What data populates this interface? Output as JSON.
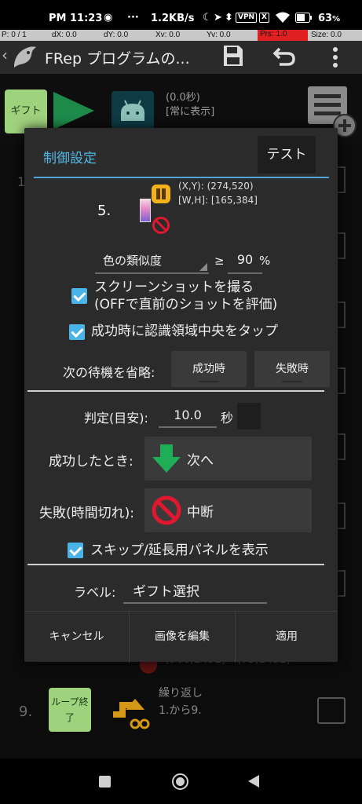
{
  "status_bar": {
    "time": "PM 11:23",
    "dots": "···",
    "speed": "1.2KB/s",
    "vpn": "VPN",
    "x_icon": "X",
    "battery": "63",
    "battery_unit": "%"
  },
  "pointer_bar": {
    "p": "P: 0 / 1",
    "dx": "dX: 0.0",
    "dy": "dY: 0.0",
    "xv": "Xv: 0.0",
    "yv": "Yv: 0.0",
    "prs": "Prs: 1.0",
    "size": "Size: 0.0",
    "highlight_color": "#e02020"
  },
  "toolbar": {
    "title": "FRep プログラムの..."
  },
  "background": {
    "gift_label": "ギフト",
    "time_line1": "(0.0秒)",
    "time_line2": "[常に表示]",
    "row1_number": "1",
    "row8_coords": "(960,1492) - (75,1492)",
    "row9_number": "9.",
    "loop_label_line1": "ループ終",
    "loop_label_line2": "了",
    "row9_desc_line1": "繰り返し",
    "row9_desc_line2": "1.から9."
  },
  "dialog": {
    "title": "制御設定",
    "test_button": "テスト",
    "step_number": "5.",
    "coords_xy": "(X,Y): (274,520)",
    "coords_wh": "[W,H]: [165,384]",
    "similarity_label": "色の類似度",
    "ge_symbol": "≥",
    "similarity_value": "90",
    "similarity_unit": "%",
    "screenshot_line1": "スクリーンショットを撮る",
    "screenshot_line2": "(OFFで直前のショットを評価)",
    "tap_center": "成功時に認識領域中央をタップ",
    "skip_wait_label": "次の待機を省略:",
    "on_success_btn": "成功時",
    "on_fail_btn": "失敗時",
    "judge_label": "判定(目安):",
    "judge_value": "10.0",
    "judge_unit": "秒",
    "success_label": "成功したとき:",
    "success_action": "次へ",
    "fail_label": "失敗(時間切れ):",
    "fail_action": "中断",
    "show_panel": "スキップ/延長用パネルを表示",
    "label_label": "ラベル:",
    "label_value": "ギフト選択",
    "cancel": "キャンセル",
    "edit_image": "画像を編集",
    "apply": "適用",
    "accent_color": "#53b8e6",
    "checkbox_color": "#4ab3e8",
    "success_icon_color": "#1fae57",
    "stop_icon_color": "#e0182f"
  }
}
